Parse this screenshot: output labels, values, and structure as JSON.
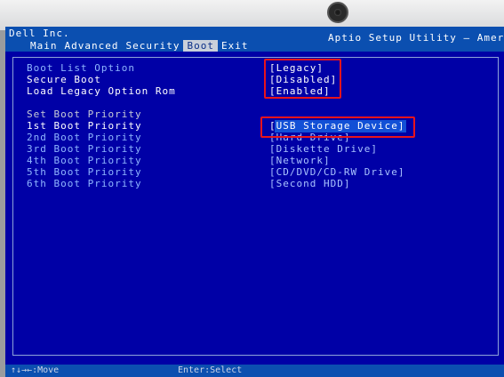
{
  "header": {
    "vendor": "Dell Inc.",
    "utility_title": "Aptio Setup Utility – Americ"
  },
  "tabs": [
    {
      "label": "Main"
    },
    {
      "label": "Advanced"
    },
    {
      "label": "Security"
    },
    {
      "label": "Boot",
      "active": true
    },
    {
      "label": "Exit"
    }
  ],
  "settings": {
    "boot_list_option": {
      "label": "Boot List Option",
      "value": "[Legacy]"
    },
    "secure_boot": {
      "label": "Secure Boot",
      "value": "[Disabled]"
    },
    "load_legacy_option_rom": {
      "label": "Load Legacy Option Rom",
      "value": "[Enabled]"
    }
  },
  "priority_heading": "Set Boot Priority",
  "priorities": [
    {
      "label": "1st Boot Priority",
      "value": "[USB Storage Device]"
    },
    {
      "label": "2nd Boot Priority",
      "value": "[Hard Drive]"
    },
    {
      "label": "3rd Boot Priority",
      "value": "[Diskette Drive]"
    },
    {
      "label": "4th Boot Priority",
      "value": "[Network]"
    },
    {
      "label": "5th Boot Priority",
      "value": "[CD/DVD/CD-RW Drive]"
    },
    {
      "label": "6th Boot Priority",
      "value": "[Second HDD]"
    }
  ],
  "footer": {
    "move": "↑↓→←:Move",
    "select": "Enter:Select"
  },
  "colors": {
    "background": "#0000a6",
    "header": "#0b4fb0",
    "annotation": "#e8141c"
  },
  "icons": {
    "webcam": "webcam-icon"
  }
}
